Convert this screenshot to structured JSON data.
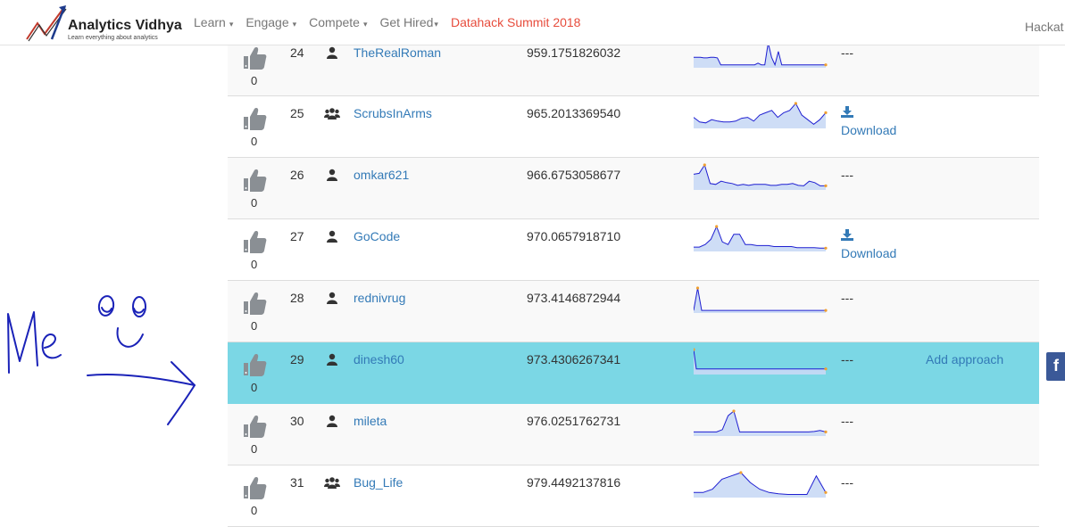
{
  "navbar": {
    "logo_title": "Analytics Vidhya",
    "logo_tagline": "Learn everything about analytics",
    "items": [
      {
        "label": "Learn",
        "caret": "▾"
      },
      {
        "label": "Engage",
        "caret": "▾"
      },
      {
        "label": "Compete",
        "caret": "▾"
      },
      {
        "label": "Get Hired",
        "caret": "▾"
      }
    ],
    "summit": "Datahack Summit 2018",
    "right_label": "Hackat"
  },
  "colors": {
    "link": "#337ab7",
    "highlight_row": "#7bd7e5",
    "spark_line": "#1f1fd1",
    "spark_fill": "#c9d9f5",
    "spark_dot": "#f0a030",
    "summit": "#e74c3c",
    "annotation": "#1a22b8"
  },
  "icons": {
    "vote": "thumbs-up-icon",
    "single": "user-icon",
    "team": "users-icon",
    "download": "download-icon",
    "share": "facebook-icon"
  },
  "leaderboard": [
    {
      "votes": "0",
      "rank": "24",
      "type": "single",
      "name": "TheRealRoman",
      "score": "959.1751826032",
      "sub": "---",
      "download": "",
      "approach": "",
      "spark": [
        15,
        15,
        15,
        14,
        14,
        15,
        15,
        14,
        2,
        2,
        2,
        2,
        2,
        2,
        2,
        2,
        2,
        2,
        2,
        5,
        2,
        2,
        40,
        15,
        2,
        25,
        2,
        2,
        2,
        2,
        2,
        2,
        2,
        2,
        2,
        2,
        2,
        2,
        2,
        2
      ]
    },
    {
      "votes": "0",
      "rank": "25",
      "type": "team",
      "name": "ScrubsInArms",
      "score": "965.2013369540",
      "sub": "",
      "download": "Download",
      "approach": "",
      "spark": [
        20,
        10,
        8,
        15,
        12,
        10,
        10,
        12,
        18,
        20,
        12,
        25,
        30,
        35,
        20,
        30,
        35,
        50,
        25,
        15,
        5,
        15,
        30
      ]
    },
    {
      "votes": "0",
      "rank": "26",
      "type": "single",
      "name": "omkar621",
      "score": "966.6753058677",
      "sub": "",
      "download": "",
      "approach": "",
      "spark": [
        30,
        32,
        50,
        10,
        8,
        15,
        12,
        10,
        6,
        8,
        6,
        8,
        8,
        8,
        6,
        6,
        8,
        8,
        10,
        6,
        5,
        15,
        12,
        5,
        5
      ]
    },
    {
      "votes": "0",
      "rank": "27",
      "type": "single",
      "name": "GoCode",
      "score": "970.0657918710",
      "sub": "",
      "download": "Download",
      "approach": "",
      "spark": [
        5,
        5,
        10,
        20,
        45,
        15,
        10,
        30,
        30,
        10,
        10,
        8,
        8,
        8,
        6,
        6,
        6,
        6,
        4,
        4,
        4,
        4,
        3,
        3
      ]
    },
    {
      "votes": "0",
      "rank": "28",
      "type": "single",
      "name": "rednivrug",
      "score": "973.4146872944",
      "sub": "",
      "download": "",
      "approach": "",
      "spark": [
        2,
        60,
        2,
        2,
        2,
        2,
        2,
        2,
        2,
        2,
        2,
        2,
        2,
        2,
        2,
        2,
        2,
        2,
        2,
        2,
        2,
        2,
        2,
        2,
        2,
        2,
        2,
        2,
        2,
        2,
        2,
        2,
        2,
        2
      ]
    },
    {
      "votes": "0",
      "rank": "29",
      "type": "single",
      "name": "dinesh60",
      "score": "973.4306267341",
      "sub": "",
      "download": "",
      "approach": "Add approach",
      "spark": [
        30,
        5,
        5,
        5,
        5,
        5,
        5,
        5,
        5,
        5,
        5,
        5,
        5,
        5,
        5,
        5,
        5,
        5,
        5,
        5,
        5,
        5,
        5,
        5,
        5,
        5,
        5,
        5,
        5,
        5,
        5,
        5,
        5,
        5,
        5,
        5,
        5,
        5,
        5,
        5,
        5,
        5,
        5,
        5,
        5,
        5,
        5,
        5,
        5,
        5
      ]
    },
    {
      "votes": "0",
      "rank": "30",
      "type": "single",
      "name": "mileta",
      "score": "976.0251762731",
      "sub": "",
      "download": "",
      "approach": "",
      "spark": [
        5,
        5,
        5,
        5,
        5,
        10,
        40,
        50,
        5,
        5,
        5,
        5,
        5,
        5,
        5,
        5,
        5,
        5,
        5,
        5,
        5,
        6,
        8,
        5
      ]
    },
    {
      "votes": "0",
      "rank": "31",
      "type": "team",
      "name": "Bug_Life",
      "score": "979.4492137816",
      "sub": "",
      "download": "",
      "approach": "",
      "spark": [
        5,
        5,
        10,
        25,
        30,
        35,
        20,
        10,
        5,
        3,
        2,
        2,
        2,
        30,
        5
      ]
    }
  ],
  "annotation_text": "Me"
}
